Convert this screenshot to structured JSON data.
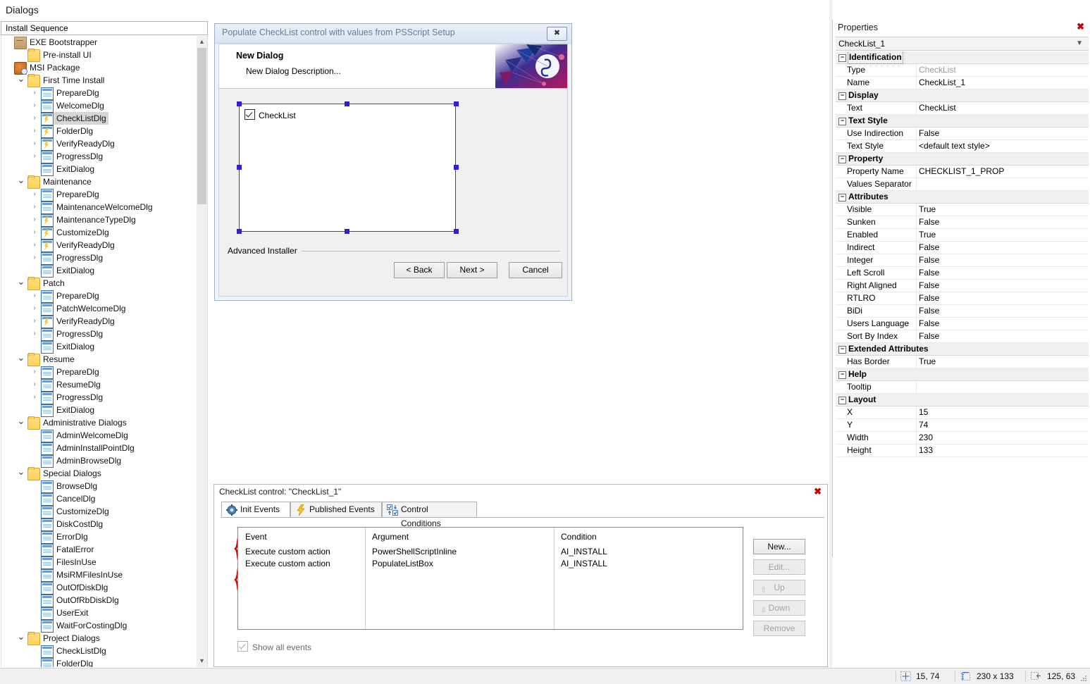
{
  "app": {
    "page_title": "Dialogs",
    "sequence_box_value": "Install Sequence"
  },
  "tree": {
    "items": [
      {
        "label": "EXE Bootstrapper",
        "depth": 0,
        "icon": "box-icon",
        "twisty": "",
        "selected": false
      },
      {
        "label": "Pre-install UI",
        "depth": 1,
        "icon": "folder-icon",
        "twisty": "",
        "selected": false
      },
      {
        "label": "MSI Package",
        "depth": 0,
        "icon": "msi-icon",
        "twisty": "",
        "selected": false
      },
      {
        "label": "First Time Install",
        "depth": 1,
        "icon": "folder-icon",
        "twisty": "v",
        "selected": false
      },
      {
        "label": "PrepareDlg",
        "depth": 2,
        "icon": "dialog-icon",
        "twisty": ">",
        "selected": false
      },
      {
        "label": "WelcomeDlg",
        "depth": 2,
        "icon": "dialog-icon",
        "twisty": ">",
        "selected": false
      },
      {
        "label": "CheckListDlg",
        "depth": 2,
        "icon": "dialog-event-icon",
        "twisty": ">",
        "selected": true
      },
      {
        "label": "FolderDlg",
        "depth": 2,
        "icon": "dialog-event-icon",
        "twisty": ">",
        "selected": false
      },
      {
        "label": "VerifyReadyDlg",
        "depth": 2,
        "icon": "dialog-event-icon",
        "twisty": ">",
        "selected": false
      },
      {
        "label": "ProgressDlg",
        "depth": 2,
        "icon": "dialog-icon",
        "twisty": ">",
        "selected": false
      },
      {
        "label": "ExitDialog",
        "depth": 2,
        "icon": "dialog-icon",
        "twisty": "",
        "selected": false
      },
      {
        "label": "Maintenance",
        "depth": 1,
        "icon": "folder-icon",
        "twisty": "v",
        "selected": false
      },
      {
        "label": "PrepareDlg",
        "depth": 2,
        "icon": "dialog-icon",
        "twisty": ">",
        "selected": false
      },
      {
        "label": "MaintenanceWelcomeDlg",
        "depth": 2,
        "icon": "dialog-icon",
        "twisty": ">",
        "selected": false
      },
      {
        "label": "MaintenanceTypeDlg",
        "depth": 2,
        "icon": "dialog-event-icon",
        "twisty": ">",
        "selected": false
      },
      {
        "label": "CustomizeDlg",
        "depth": 2,
        "icon": "dialog-event-icon",
        "twisty": ">",
        "selected": false
      },
      {
        "label": "VerifyReadyDlg",
        "depth": 2,
        "icon": "dialog-event-icon",
        "twisty": ">",
        "selected": false
      },
      {
        "label": "ProgressDlg",
        "depth": 2,
        "icon": "dialog-icon",
        "twisty": ">",
        "selected": false
      },
      {
        "label": "ExitDialog",
        "depth": 2,
        "icon": "dialog-icon",
        "twisty": "",
        "selected": false
      },
      {
        "label": "Patch",
        "depth": 1,
        "icon": "folder-icon",
        "twisty": "v",
        "selected": false
      },
      {
        "label": "PrepareDlg",
        "depth": 2,
        "icon": "dialog-icon",
        "twisty": ">",
        "selected": false
      },
      {
        "label": "PatchWelcomeDlg",
        "depth": 2,
        "icon": "dialog-icon",
        "twisty": ">",
        "selected": false
      },
      {
        "label": "VerifyReadyDlg",
        "depth": 2,
        "icon": "dialog-event-icon",
        "twisty": ">",
        "selected": false
      },
      {
        "label": "ProgressDlg",
        "depth": 2,
        "icon": "dialog-icon",
        "twisty": ">",
        "selected": false
      },
      {
        "label": "ExitDialog",
        "depth": 2,
        "icon": "dialog-icon",
        "twisty": "",
        "selected": false
      },
      {
        "label": "Resume",
        "depth": 1,
        "icon": "folder-icon",
        "twisty": "v",
        "selected": false
      },
      {
        "label": "PrepareDlg",
        "depth": 2,
        "icon": "dialog-icon",
        "twisty": ">",
        "selected": false
      },
      {
        "label": "ResumeDlg",
        "depth": 2,
        "icon": "dialog-icon",
        "twisty": ">",
        "selected": false
      },
      {
        "label": "ProgressDlg",
        "depth": 2,
        "icon": "dialog-icon",
        "twisty": ">",
        "selected": false
      },
      {
        "label": "ExitDialog",
        "depth": 2,
        "icon": "dialog-icon",
        "twisty": "",
        "selected": false
      },
      {
        "label": "Administrative Dialogs",
        "depth": 1,
        "icon": "folder-icon",
        "twisty": "v",
        "selected": false
      },
      {
        "label": "AdminWelcomeDlg",
        "depth": 2,
        "icon": "dialog-icon",
        "twisty": "",
        "selected": false
      },
      {
        "label": "AdminInstallPointDlg",
        "depth": 2,
        "icon": "dialog-icon",
        "twisty": "",
        "selected": false
      },
      {
        "label": "AdminBrowseDlg",
        "depth": 2,
        "icon": "dialog-icon",
        "twisty": "",
        "selected": false
      },
      {
        "label": "Special Dialogs",
        "depth": 1,
        "icon": "folder-icon",
        "twisty": "v",
        "selected": false
      },
      {
        "label": "BrowseDlg",
        "depth": 2,
        "icon": "dialog-icon",
        "twisty": "",
        "selected": false
      },
      {
        "label": "CancelDlg",
        "depth": 2,
        "icon": "dialog-icon",
        "twisty": "",
        "selected": false
      },
      {
        "label": "CustomizeDlg",
        "depth": 2,
        "icon": "dialog-icon",
        "twisty": "",
        "selected": false
      },
      {
        "label": "DiskCostDlg",
        "depth": 2,
        "icon": "dialog-icon",
        "twisty": "",
        "selected": false
      },
      {
        "label": "ErrorDlg",
        "depth": 2,
        "icon": "dialog-icon",
        "twisty": "",
        "selected": false
      },
      {
        "label": "FatalError",
        "depth": 2,
        "icon": "dialog-icon",
        "twisty": "",
        "selected": false
      },
      {
        "label": "FilesInUse",
        "depth": 2,
        "icon": "dialog-icon",
        "twisty": "",
        "selected": false
      },
      {
        "label": "MsiRMFilesInUse",
        "depth": 2,
        "icon": "dialog-icon",
        "twisty": "",
        "selected": false
      },
      {
        "label": "OutOfDiskDlg",
        "depth": 2,
        "icon": "dialog-icon",
        "twisty": "",
        "selected": false
      },
      {
        "label": "OutOfRbDiskDlg",
        "depth": 2,
        "icon": "dialog-icon",
        "twisty": "",
        "selected": false
      },
      {
        "label": "UserExit",
        "depth": 2,
        "icon": "dialog-icon",
        "twisty": "",
        "selected": false
      },
      {
        "label": "WaitForCostingDlg",
        "depth": 2,
        "icon": "dialog-icon",
        "twisty": "",
        "selected": false
      },
      {
        "label": "Project Dialogs",
        "depth": 1,
        "icon": "folder-icon",
        "twisty": "v",
        "selected": false
      },
      {
        "label": "CheckListDlg",
        "depth": 2,
        "icon": "dialog-icon",
        "twisty": "",
        "selected": false
      },
      {
        "label": "FolderDlg",
        "depth": 2,
        "icon": "dialog-icon",
        "twisty": "",
        "selected": false
      }
    ]
  },
  "dialog_preview": {
    "titlebar": "Populate CheckList control with values from PSScript Setup",
    "close_label": "✖",
    "banner_title": "New Dialog",
    "banner_description": "New Dialog Description...",
    "checklist_label": "CheckList",
    "footer_brand": "Advanced Installer",
    "buttons": {
      "back": "< Back",
      "next": "Next >",
      "cancel": "Cancel"
    }
  },
  "properties": {
    "panel_title": "Properties",
    "close_label": "✖",
    "selected_object": "CheckList_1",
    "groups": [
      {
        "name": "Identification",
        "dotted": true,
        "rows": [
          {
            "name": "Type",
            "value": "CheckList",
            "gray": true
          },
          {
            "name": "Name",
            "value": "CheckList_1",
            "gray": false
          }
        ]
      },
      {
        "name": "Display",
        "dotted": false,
        "rows": [
          {
            "name": "Text",
            "value": "CheckList",
            "gray": false
          }
        ]
      },
      {
        "name": "Text Style",
        "dotted": false,
        "rows": [
          {
            "name": "Use Indirection",
            "value": "False",
            "gray": false
          },
          {
            "name": "Text Style",
            "value": "<default text style>",
            "gray": false
          }
        ]
      },
      {
        "name": "Property",
        "dotted": false,
        "rows": [
          {
            "name": "Property Name",
            "value": "CHECKLIST_1_PROP",
            "gray": false
          },
          {
            "name": "Values Separator",
            "value": "",
            "gray": false
          }
        ]
      },
      {
        "name": "Attributes",
        "dotted": false,
        "rows": [
          {
            "name": "Visible",
            "value": "True",
            "gray": false
          },
          {
            "name": "Sunken",
            "value": "False",
            "gray": false
          },
          {
            "name": "Enabled",
            "value": "True",
            "gray": false
          },
          {
            "name": "Indirect",
            "value": "False",
            "gray": false
          },
          {
            "name": "Integer",
            "value": "False",
            "gray": false
          },
          {
            "name": "Left Scroll",
            "value": "False",
            "gray": false
          },
          {
            "name": "Right Aligned",
            "value": "False",
            "gray": false
          },
          {
            "name": "RTLRO",
            "value": "False",
            "gray": false
          },
          {
            "name": "BiDi",
            "value": "False",
            "gray": false
          },
          {
            "name": "Users Language",
            "value": "False",
            "gray": false
          },
          {
            "name": "Sort By Index",
            "value": "False",
            "gray": false
          }
        ]
      },
      {
        "name": "Extended Attributes",
        "dotted": false,
        "rows": [
          {
            "name": "Has Border",
            "value": "True",
            "gray": false
          }
        ]
      },
      {
        "name": "Help",
        "dotted": false,
        "rows": [
          {
            "name": "Tooltip",
            "value": "",
            "gray": false
          }
        ]
      },
      {
        "name": "Layout",
        "dotted": false,
        "rows": [
          {
            "name": "X",
            "value": "15",
            "gray": false
          },
          {
            "name": "Y",
            "value": "74",
            "gray": false
          },
          {
            "name": "Width",
            "value": "230",
            "gray": false
          },
          {
            "name": "Height",
            "value": "133",
            "gray": false
          }
        ]
      }
    ]
  },
  "events_panel": {
    "title": "CheckList control: \"CheckList_1\"",
    "close_label": "✖",
    "tabs": [
      {
        "label": "Init Events",
        "icon": "gear-blue-icon",
        "active": true
      },
      {
        "label": "Published Events",
        "icon": "lightning-icon",
        "active": false
      },
      {
        "label": "Control Conditions",
        "icon": "checkbox-arrows-icon",
        "active": false
      }
    ],
    "columns": [
      "Event",
      "Argument",
      "Condition"
    ],
    "rows": [
      {
        "event": "Execute custom action",
        "argument": "PowerShellScriptInline",
        "condition": "AI_INSTALL"
      },
      {
        "event": "Execute custom action",
        "argument": "PopulateListBox",
        "condition": "AI_INSTALL"
      }
    ],
    "show_all_events_label": "Show all events",
    "buttons": [
      {
        "label": "New...",
        "disabled": false,
        "arrow": ""
      },
      {
        "label": "Edit...",
        "disabled": true,
        "arrow": ""
      },
      {
        "label": "Up",
        "disabled": true,
        "arrow": "⇧"
      },
      {
        "label": "Down",
        "disabled": true,
        "arrow": "⇩"
      },
      {
        "label": "Remove",
        "disabled": true,
        "arrow": ""
      }
    ]
  },
  "statusbar": {
    "position": "15, 74",
    "size": "230 x 133",
    "cursor": "125, 63"
  },
  "colors": {
    "selection_handle": "#3a1ad0",
    "annotation_red": "#cc0000",
    "close_red": "#c00000",
    "tree_selection": "#d6d6d6"
  }
}
